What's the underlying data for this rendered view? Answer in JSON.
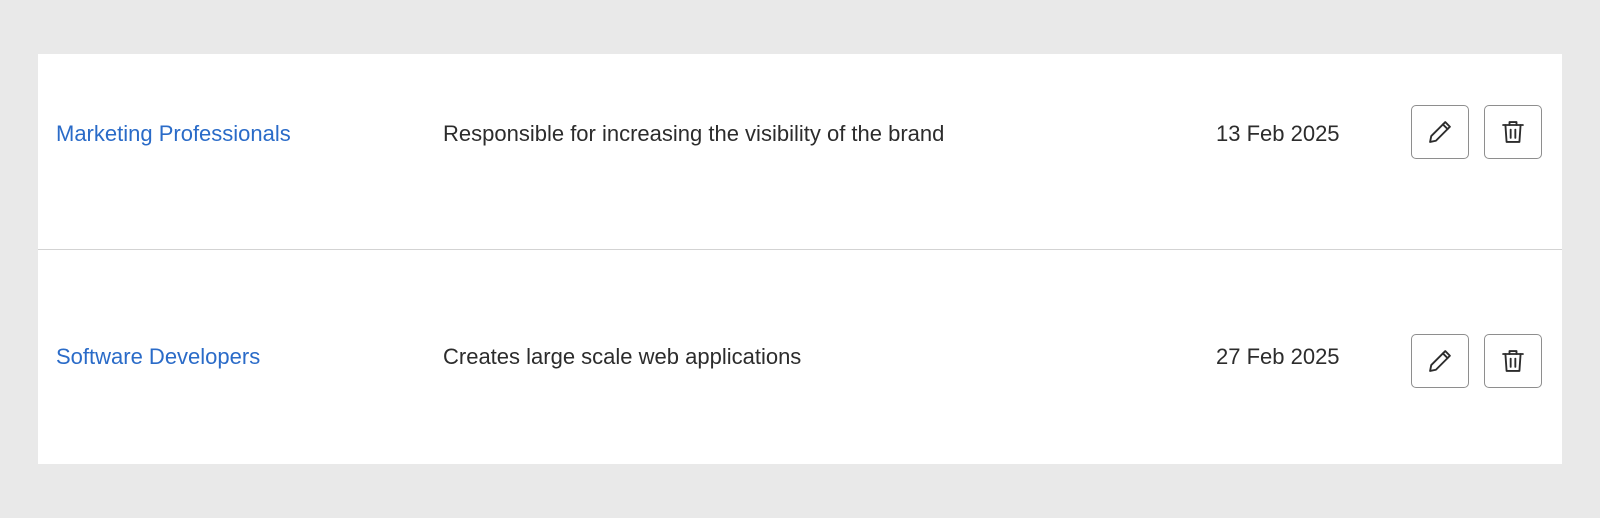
{
  "table": {
    "rows": [
      {
        "name": "Marketing Professionals",
        "description": "Responsible for increasing the visibility of the brand",
        "date": "13 Feb 2025",
        "edit_icon": "pencil-icon",
        "delete_icon": "trash-icon"
      },
      {
        "name": "Software Developers",
        "description": "Creates large scale web applications",
        "date": "27 Feb 2025",
        "edit_icon": "pencil-icon",
        "delete_icon": "trash-icon"
      }
    ]
  },
  "colors": {
    "page_background": "#e9e9e9",
    "table_background": "#ffffff",
    "link": "#2a6bc8",
    "text": "#2c2c2c",
    "divider": "#d3d3d3",
    "button_border": "#8e8e8e"
  }
}
